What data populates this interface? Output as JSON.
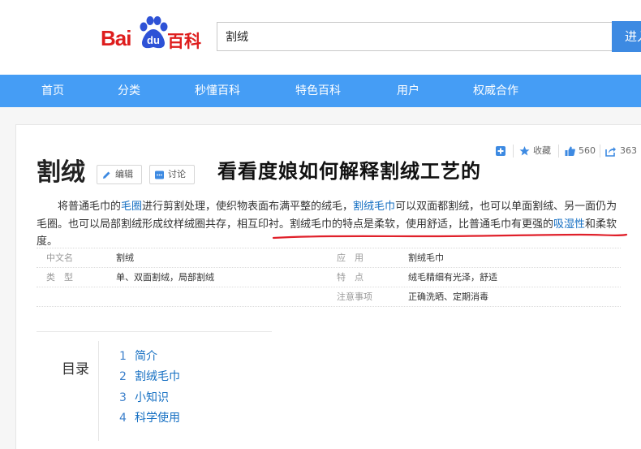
{
  "header": {
    "logo_bai": "Bai",
    "logo_du": "du",
    "logo_baike": "百科",
    "search_value": "割绒",
    "search_button": "进入"
  },
  "nav": [
    "首页",
    "分类",
    "秒懂百科",
    "特色百科",
    "用户",
    "权威合作"
  ],
  "toolbar": {
    "favorite": "收藏",
    "likes": "560",
    "shares": "363"
  },
  "entry": {
    "title": "割绒",
    "edit": "编辑",
    "discuss": "讨论",
    "overlay_text": "看看度娘如何解释割绒工艺的",
    "summary": {
      "p1": "将普通毛巾的",
      "link1": "毛圈",
      "p2": "进行剪割处理，使织物表面布满平整的绒毛，",
      "link2": "割绒毛巾",
      "p3": "可以双面都割绒，也可以单面割绒、另一面仍为毛圈。也可以局部割绒形成纹样绒圈共存，相互印衬。割绒毛巾的特点是柔软，使用舒适，比普通毛巾有更强的",
      "link3": "吸湿性",
      "p4": "和柔软度。"
    }
  },
  "info": {
    "left": [
      {
        "k": "中文名",
        "v": "割绒"
      },
      {
        "k": "类　型",
        "v": "单、双面割绒，局部割绒"
      }
    ],
    "right": [
      {
        "k": "应　用",
        "v": "割绒毛巾"
      },
      {
        "k": "特　点",
        "v": "绒毛精细有光泽，舒适"
      },
      {
        "k": "注意事项",
        "v": "正确洗晒、定期消毒"
      }
    ]
  },
  "toc": {
    "title": "目录",
    "items": [
      {
        "num": "1",
        "label": "简介"
      },
      {
        "num": "2",
        "label": "割绒毛巾"
      },
      {
        "num": "3",
        "label": "小知识"
      },
      {
        "num": "4",
        "label": "科学使用"
      }
    ]
  },
  "colors": {
    "nav": "#459df5",
    "brand_red": "#de1d1d",
    "brand_blue": "#2e52d6",
    "link": "#136ec2",
    "annotation": "#e0202a"
  }
}
